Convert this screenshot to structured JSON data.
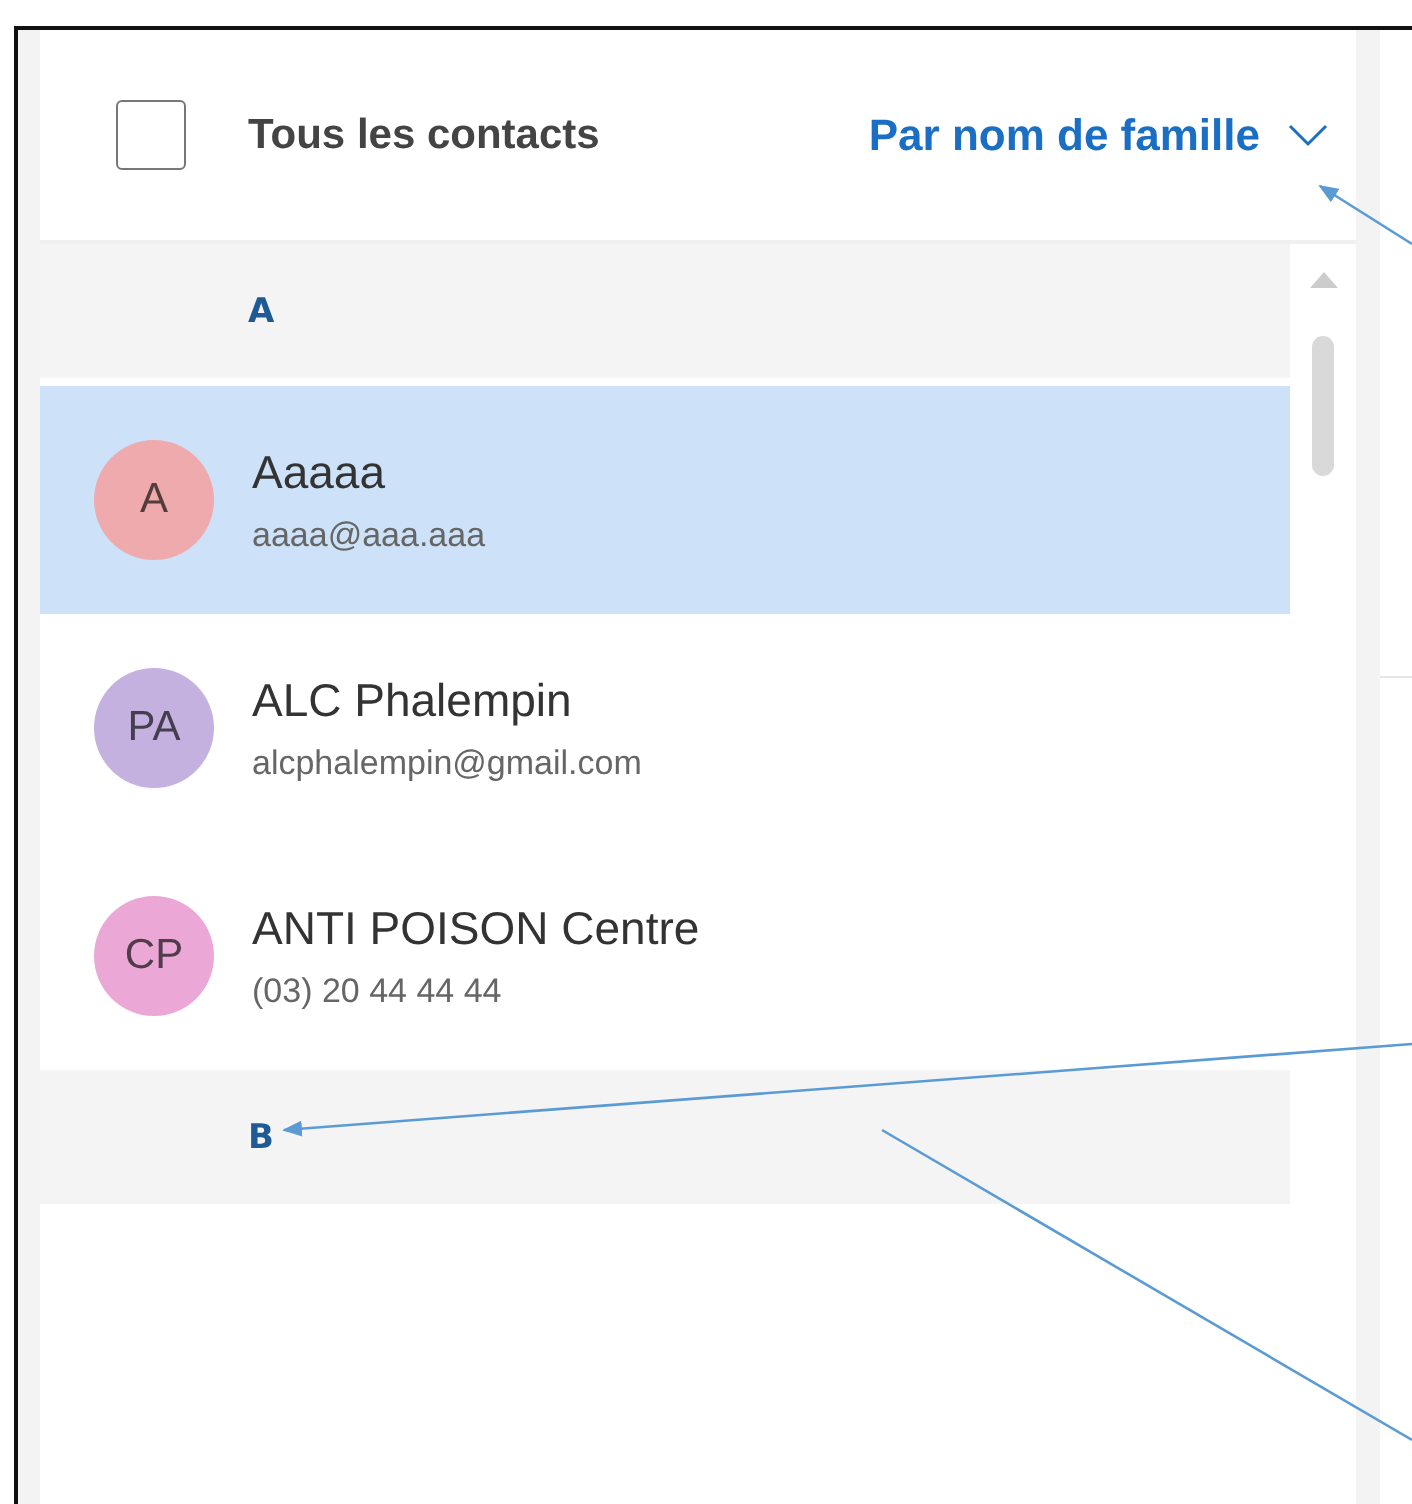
{
  "header": {
    "select_all_checked": false,
    "title": "Tous les contacts",
    "sort": "Par nom de famille"
  },
  "groups": [
    {
      "letter": "A",
      "contacts": [
        {
          "initials": "A",
          "name": "Aaaaa",
          "detail": "aaaa@aaa.aaa",
          "color": "#eeaaac",
          "selected": true
        },
        {
          "initials": "PA",
          "name": "ALC Phalempin",
          "detail": "alcphalempin@gmail.com",
          "color": "#c5b1df",
          "selected": false
        },
        {
          "initials": "CP",
          "name": "ANTI POISON Centre",
          "detail": "(03) 20 44 44 44",
          "color": "#eba8d6",
          "selected": false
        }
      ]
    },
    {
      "letter": "B"
    }
  ]
}
